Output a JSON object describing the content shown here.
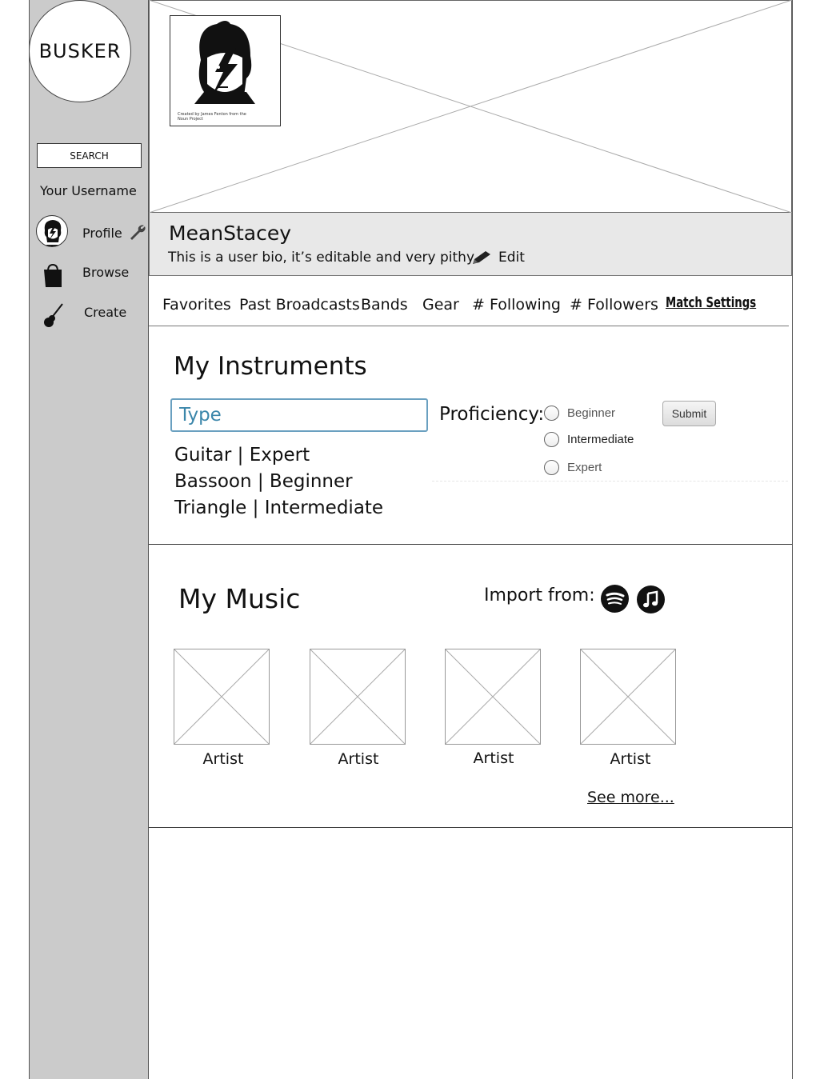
{
  "sidebar": {
    "logo": "BUSKER",
    "search_label": "SEARCH",
    "username": "Your Username",
    "items": [
      {
        "label": "Profile",
        "icon": "wrench-icon"
      },
      {
        "label": "Browse",
        "icon": "shopping-bag-icon"
      },
      {
        "label": "Create",
        "icon": "guitar-icon"
      }
    ]
  },
  "profile": {
    "credit": "Created by James Fenton from the Noun Project",
    "name": "MeanStacey",
    "bio": "This is a user bio, it’s editable and very pithy.",
    "edit_label": "Edit"
  },
  "tabs": [
    "Favorites",
    "Past Broadcasts",
    "Bands",
    "Gear",
    "# Following",
    "# Followers",
    "Match Settings"
  ],
  "instruments": {
    "title": "My Instruments",
    "input_placeholder": "Type",
    "proficiency_label": "Proficiency:",
    "options": [
      "Beginner",
      "Intermediate",
      "Expert"
    ],
    "submit_label": "Submit",
    "list": [
      "Guitar | Expert",
      "Bassoon | Beginner",
      "Triangle | Intermediate"
    ]
  },
  "music": {
    "title": "My Music",
    "import_label": "Import from:",
    "services": [
      "spotify-icon",
      "apple-music-icon"
    ],
    "artists": [
      "Artist",
      "Artist",
      "Artist",
      "Artist"
    ],
    "see_more": "See more..."
  }
}
